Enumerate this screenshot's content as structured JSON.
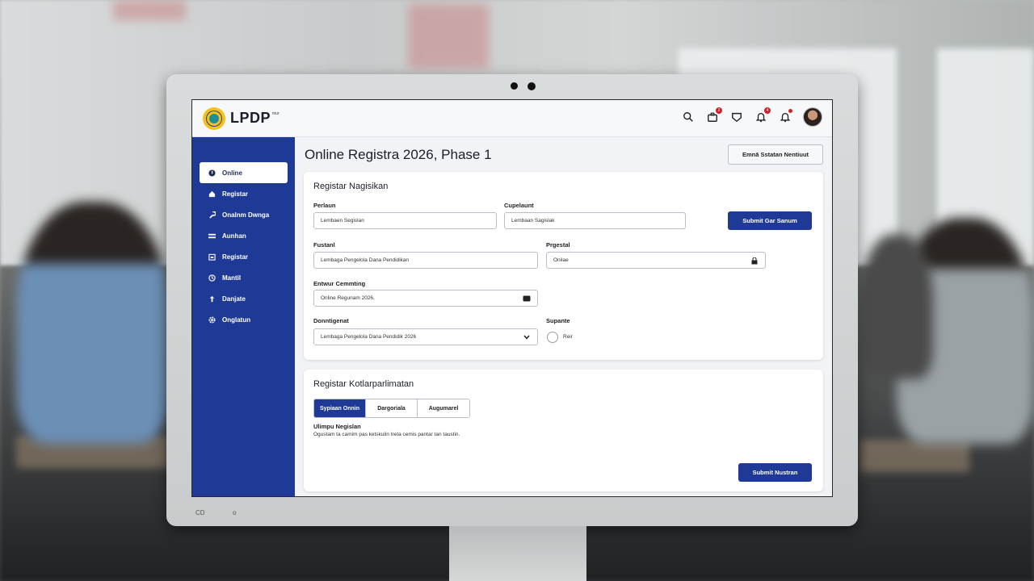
{
  "app": {
    "logo_text": "LPDP",
    "logo_sup": "mur"
  },
  "topbar": {
    "icons": [
      {
        "name": "search-icon",
        "badge": ""
      },
      {
        "name": "briefcase-icon",
        "badge": "2"
      },
      {
        "name": "shield-icon",
        "badge": ""
      },
      {
        "name": "bell-icon",
        "badge": "4"
      },
      {
        "name": "notification-icon",
        "badge": ""
      }
    ]
  },
  "sidebar": {
    "items": [
      {
        "label": "Online",
        "icon": "info-icon",
        "active": true
      },
      {
        "label": "Registar",
        "icon": "home-icon",
        "active": false
      },
      {
        "label": "Onalnm Dwnga",
        "icon": "wrench-icon",
        "active": false
      },
      {
        "label": "Aunhan",
        "icon": "list-icon",
        "active": false
      },
      {
        "label": "Registar",
        "icon": "calendar-icon",
        "active": false
      },
      {
        "label": "Mantil",
        "icon": "clock-icon",
        "active": false
      },
      {
        "label": "Danjate",
        "icon": "upload-icon",
        "active": false
      },
      {
        "label": "Onglatun",
        "icon": "gear-icon",
        "active": false
      }
    ]
  },
  "main": {
    "title": "Online Registra 2026, Phase 1",
    "title_button": "Emnā Sstatan Nentiuut",
    "form": {
      "title": "Registar Nagisikan",
      "field1": {
        "label": "Perlaun",
        "value": "Lembaen Segislan"
      },
      "field2": {
        "label": "Cupelaunt",
        "value": "Lembaan Sagislak"
      },
      "field3": {
        "label": "Fustanl",
        "value": "Lembaga Pengelola Dana Pendidikan"
      },
      "field4": {
        "label": "Prgestal",
        "value": "Onilae"
      },
      "field5": {
        "label": "Entwur Cemmting",
        "value": "Online Regunam 2026,"
      },
      "field6": {
        "label": "Donntigenat",
        "value": "Lembaga Pengelola Dana Pendidik 2026"
      },
      "radio": {
        "label": "Supante",
        "option": "Reir"
      },
      "submit": "Submit Gar Sanum"
    },
    "card2": {
      "title": "Registar Kotlarparlimatan",
      "tabs": [
        {
          "label": "Sypiaan Onnin",
          "active": true
        },
        {
          "label": "Dargoriala",
          "active": false
        },
        {
          "label": "Augumarel",
          "active": false
        }
      ],
      "sub_label": "Ulimpu Negislan",
      "sub_text": "Ogustam ta camim pas ketskulin treta cemis pantar tan taustin.",
      "submit": "Submit Nustran"
    }
  },
  "colors": {
    "sidebar": "#1e3a96",
    "primary": "#1e3a96",
    "badge": "#d1202a"
  }
}
